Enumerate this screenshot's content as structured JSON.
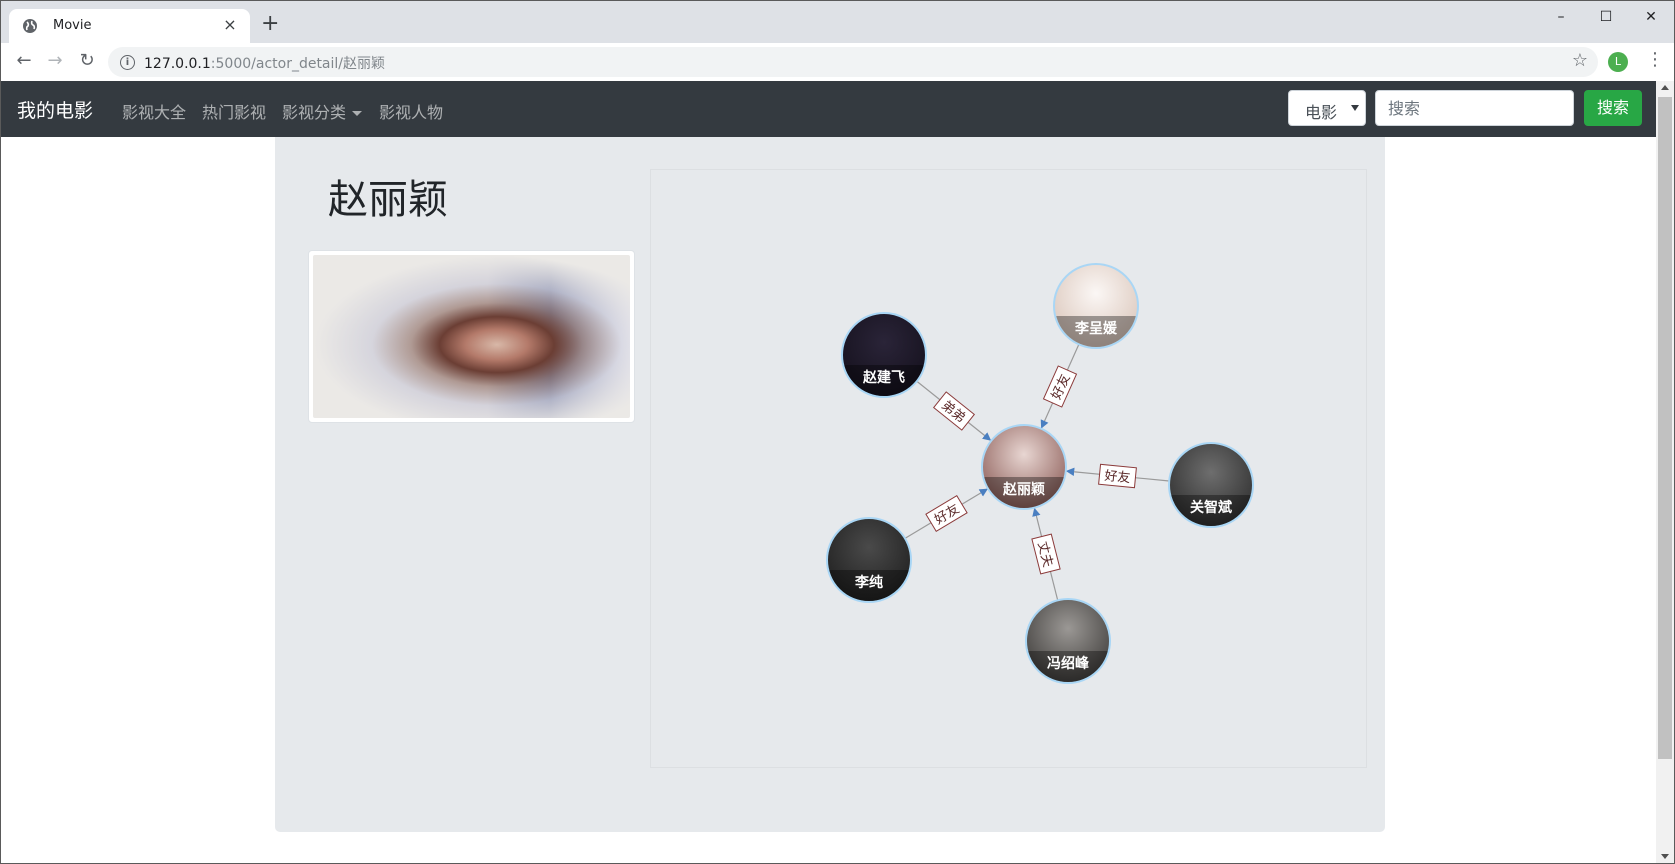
{
  "browser": {
    "tab_title": "Movie",
    "tab_close": "×",
    "new_tab": "+",
    "url_host": "127.0.0.1",
    "url_rest": ":5000/actor_detail/赵丽颖",
    "profile_initial": "L"
  },
  "navbar": {
    "brand": "我的电影",
    "links": [
      "影视大全",
      "热门影视",
      "影视分类",
      "影视人物"
    ],
    "search_type": "电影",
    "search_placeholder": "搜索",
    "search_button": "搜索"
  },
  "actor": {
    "name": "赵丽颖"
  },
  "graph": {
    "center": {
      "name": "赵丽颖"
    },
    "nodes": [
      {
        "name": "李呈媛",
        "relation": "好友"
      },
      {
        "name": "赵建飞",
        "relation": "弟弟"
      },
      {
        "name": "关智斌",
        "relation": "好友"
      },
      {
        "name": "李纯",
        "relation": "好友"
      },
      {
        "name": "冯绍峰",
        "relation": "丈夫"
      }
    ],
    "colors": {
      "edge": "#9a9a9a",
      "arrow": "#4a7fc1",
      "node_border": "#a9d6f5",
      "label_border": "#8b3a3a"
    }
  }
}
